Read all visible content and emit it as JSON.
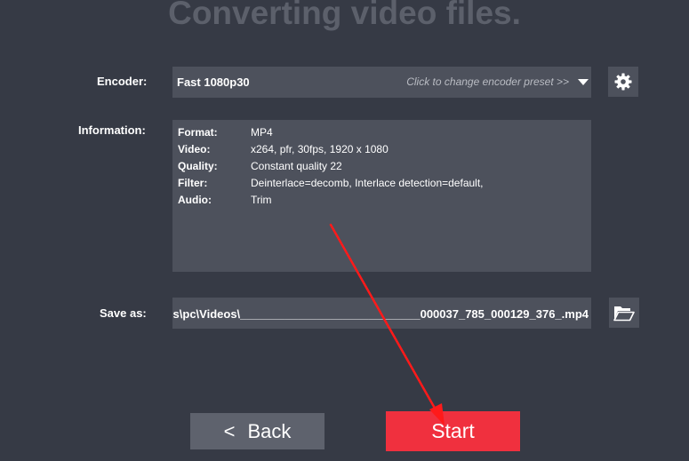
{
  "header": {
    "title": "Converting video files."
  },
  "encoder": {
    "label": "Encoder:",
    "value": "Fast 1080p30",
    "hint": "Click to change encoder preset >>",
    "settings_icon": "gear-icon"
  },
  "information": {
    "label": "Information:",
    "rows": [
      {
        "key": "Format:",
        "value": "MP4"
      },
      {
        "key": "Video:",
        "value": "x264, pfr, 30fps, 1920 x 1080"
      },
      {
        "key": "Quality:",
        "value": "Constant quality 22"
      },
      {
        "key": "Filter:",
        "value": "Deinterlace=decomb, Interlace detection=default,"
      },
      {
        "key": "Audio:",
        "value": "Trim"
      }
    ]
  },
  "save": {
    "label": "Save as:",
    "value": "s\\pc\\Videos\\____________________________000037_785_000129_376_.mp4",
    "browse_icon": "folder-open-icon"
  },
  "buttons": {
    "back_chevron": "<",
    "back_label": "Back",
    "start_label": "Start"
  },
  "colors": {
    "background": "#363a45",
    "field": "#4d515c",
    "start": "#f0303e",
    "back": "#5e626d",
    "annotation_arrow": "#ff1a1a"
  }
}
